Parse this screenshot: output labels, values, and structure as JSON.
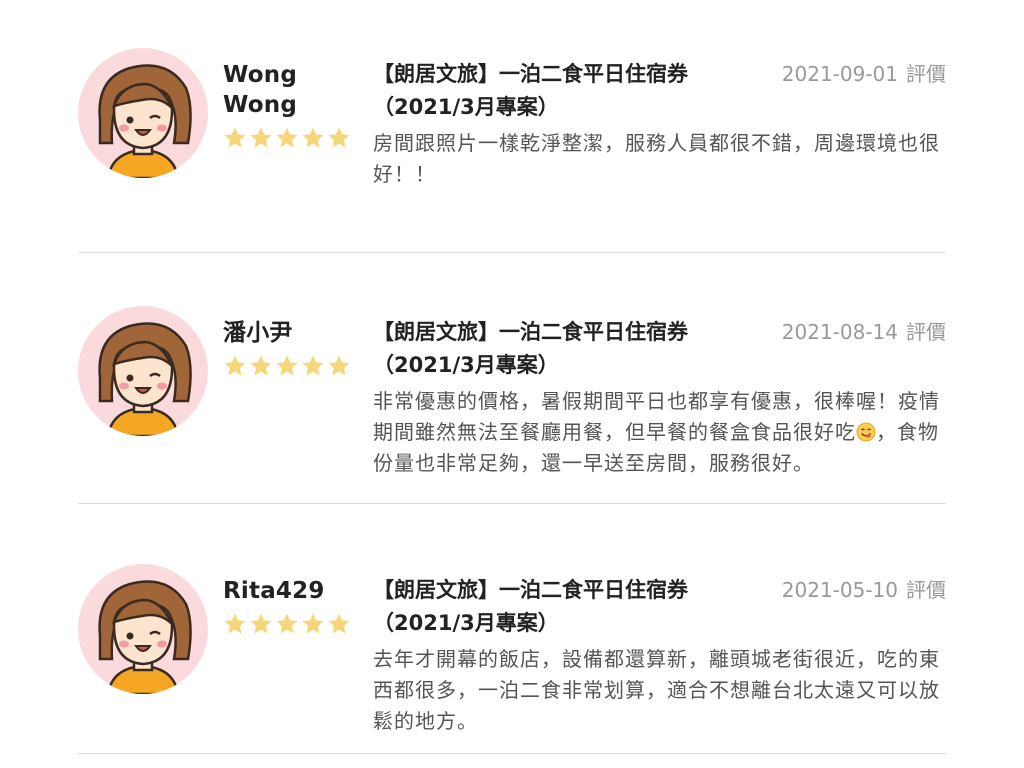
{
  "reviews": [
    {
      "username": "Wong Wong",
      "rating": 5,
      "product_title": "【朗居文旅】一泊二食平日住宿券（2021/3月專案）",
      "date": "2021-09-01",
      "rate_label": "評價",
      "text": "房間跟照片一樣乾淨整潔，服務人員都很不錯，周邊環境也很好！！"
    },
    {
      "username": "潘小尹",
      "rating": 5,
      "product_title": "【朗居文旅】一泊二食平日住宿券（2021/3月專案）",
      "date": "2021-08-14",
      "rate_label": "評價",
      "text_before_emoji": "非常優惠的價格，暑假期間平日也都享有優惠，很棒喔！疫情期間雖然無法至餐廳用餐，但早餐的餐盒食品很好吃",
      "text_after_emoji": "，食物 份量也非常足夠，還一早送至房間，服務很好。",
      "emoji": "face-savoring-food-icon"
    },
    {
      "username": "Rita429",
      "rating": 5,
      "product_title": "【朗居文旅】一泊二食平日住宿券（2021/3月專案）",
      "date": "2021-05-10",
      "rate_label": "評價",
      "text": "去年才開幕的飯店，設備都還算新，離頭城老街很近，吃的東西都很多，一泊二食非常划算，適合不想離台北太遠又可以放鬆的地方。"
    }
  ],
  "colors": {
    "star": "#F5D77A",
    "avatar_bg": "#FADADD",
    "hair": "#A0663A",
    "shirt": "#F5A623",
    "meta_text": "#999999",
    "divider": "#DCDCDC"
  }
}
